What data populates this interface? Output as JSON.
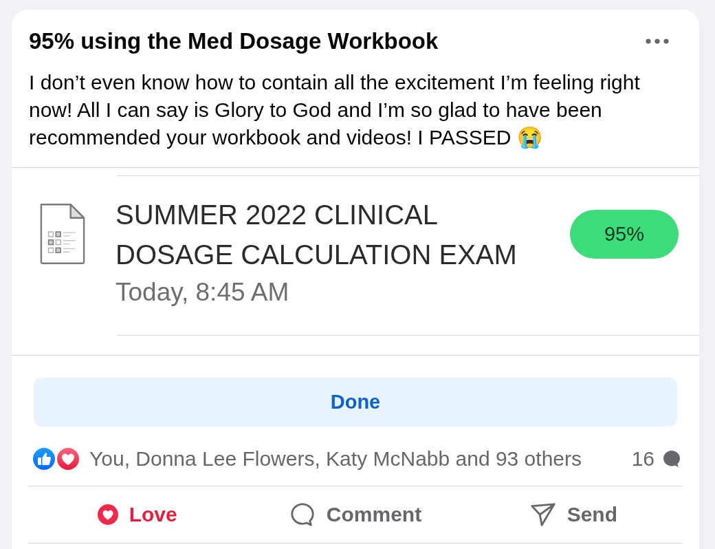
{
  "post": {
    "title": "95% using the Med Dosage Workbook",
    "text": "I don’t even know how to contain all the excitement I’m feeling right now! All I can say is Glory to God and I’m so glad to have been recommended your workbook and videos! I PASSED 😭"
  },
  "attachment": {
    "title": "SUMMER 2022 CLINICAL DOSAGE CALCULATION EXAM",
    "date": "Today, 8:45 AM",
    "score": "95%"
  },
  "done_button": {
    "label": "Done"
  },
  "reactions": {
    "icons": [
      {
        "kind": "like"
      },
      {
        "kind": "love"
      }
    ],
    "summary": "You, Donna Lee Flowers, Katy McNabb and 93 others",
    "comment_count": "16"
  },
  "actions": [
    {
      "kind": "love",
      "label": "Love",
      "selected": true
    },
    {
      "kind": "comment",
      "label": "Comment",
      "selected": false
    },
    {
      "kind": "send",
      "label": "Send",
      "selected": false
    }
  ]
}
